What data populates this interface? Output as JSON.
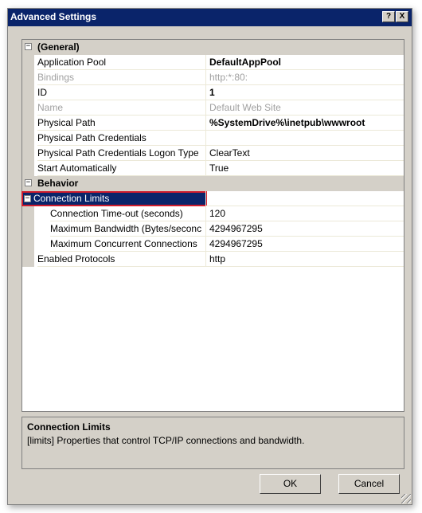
{
  "window": {
    "title": "Advanced Settings",
    "help_btn": "?",
    "close_btn": "X"
  },
  "grid": {
    "general": {
      "label": "(General)",
      "rows": [
        {
          "name": "Application Pool",
          "value": "DefaultAppPool"
        },
        {
          "name": "Bindings",
          "value": "http:*:80:"
        },
        {
          "name": "ID",
          "value": "1"
        },
        {
          "name": "Name",
          "value": "Default Web Site"
        },
        {
          "name": "Physical Path",
          "value": "%SystemDrive%\\inetpub\\wwwroot"
        },
        {
          "name": "Physical Path Credentials",
          "value": ""
        },
        {
          "name": "Physical Path Credentials Logon Type",
          "value": "ClearText"
        },
        {
          "name": "Start Automatically",
          "value": "True"
        }
      ]
    },
    "behavior": {
      "label": "Behavior",
      "connection_limits": {
        "label": "Connection Limits",
        "rows": [
          {
            "name": "Connection Time-out (seconds)",
            "value": "120"
          },
          {
            "name": "Maximum Bandwidth (Bytes/seconc",
            "value": "4294967295"
          },
          {
            "name": "Maximum Concurrent Connections",
            "value": "4294967295"
          }
        ]
      },
      "enabled_protocols": {
        "name": "Enabled Protocols",
        "value": "http"
      }
    },
    "expander_symbol": "−"
  },
  "description": {
    "title": "Connection Limits",
    "text": "[limits] Properties that control TCP/IP connections and bandwidth."
  },
  "buttons": {
    "ok": "OK",
    "cancel": "Cancel"
  },
  "colors": {
    "titlebar": "#0a246a",
    "selection": "#0a246a",
    "highlight_border": "#d01c2c"
  }
}
